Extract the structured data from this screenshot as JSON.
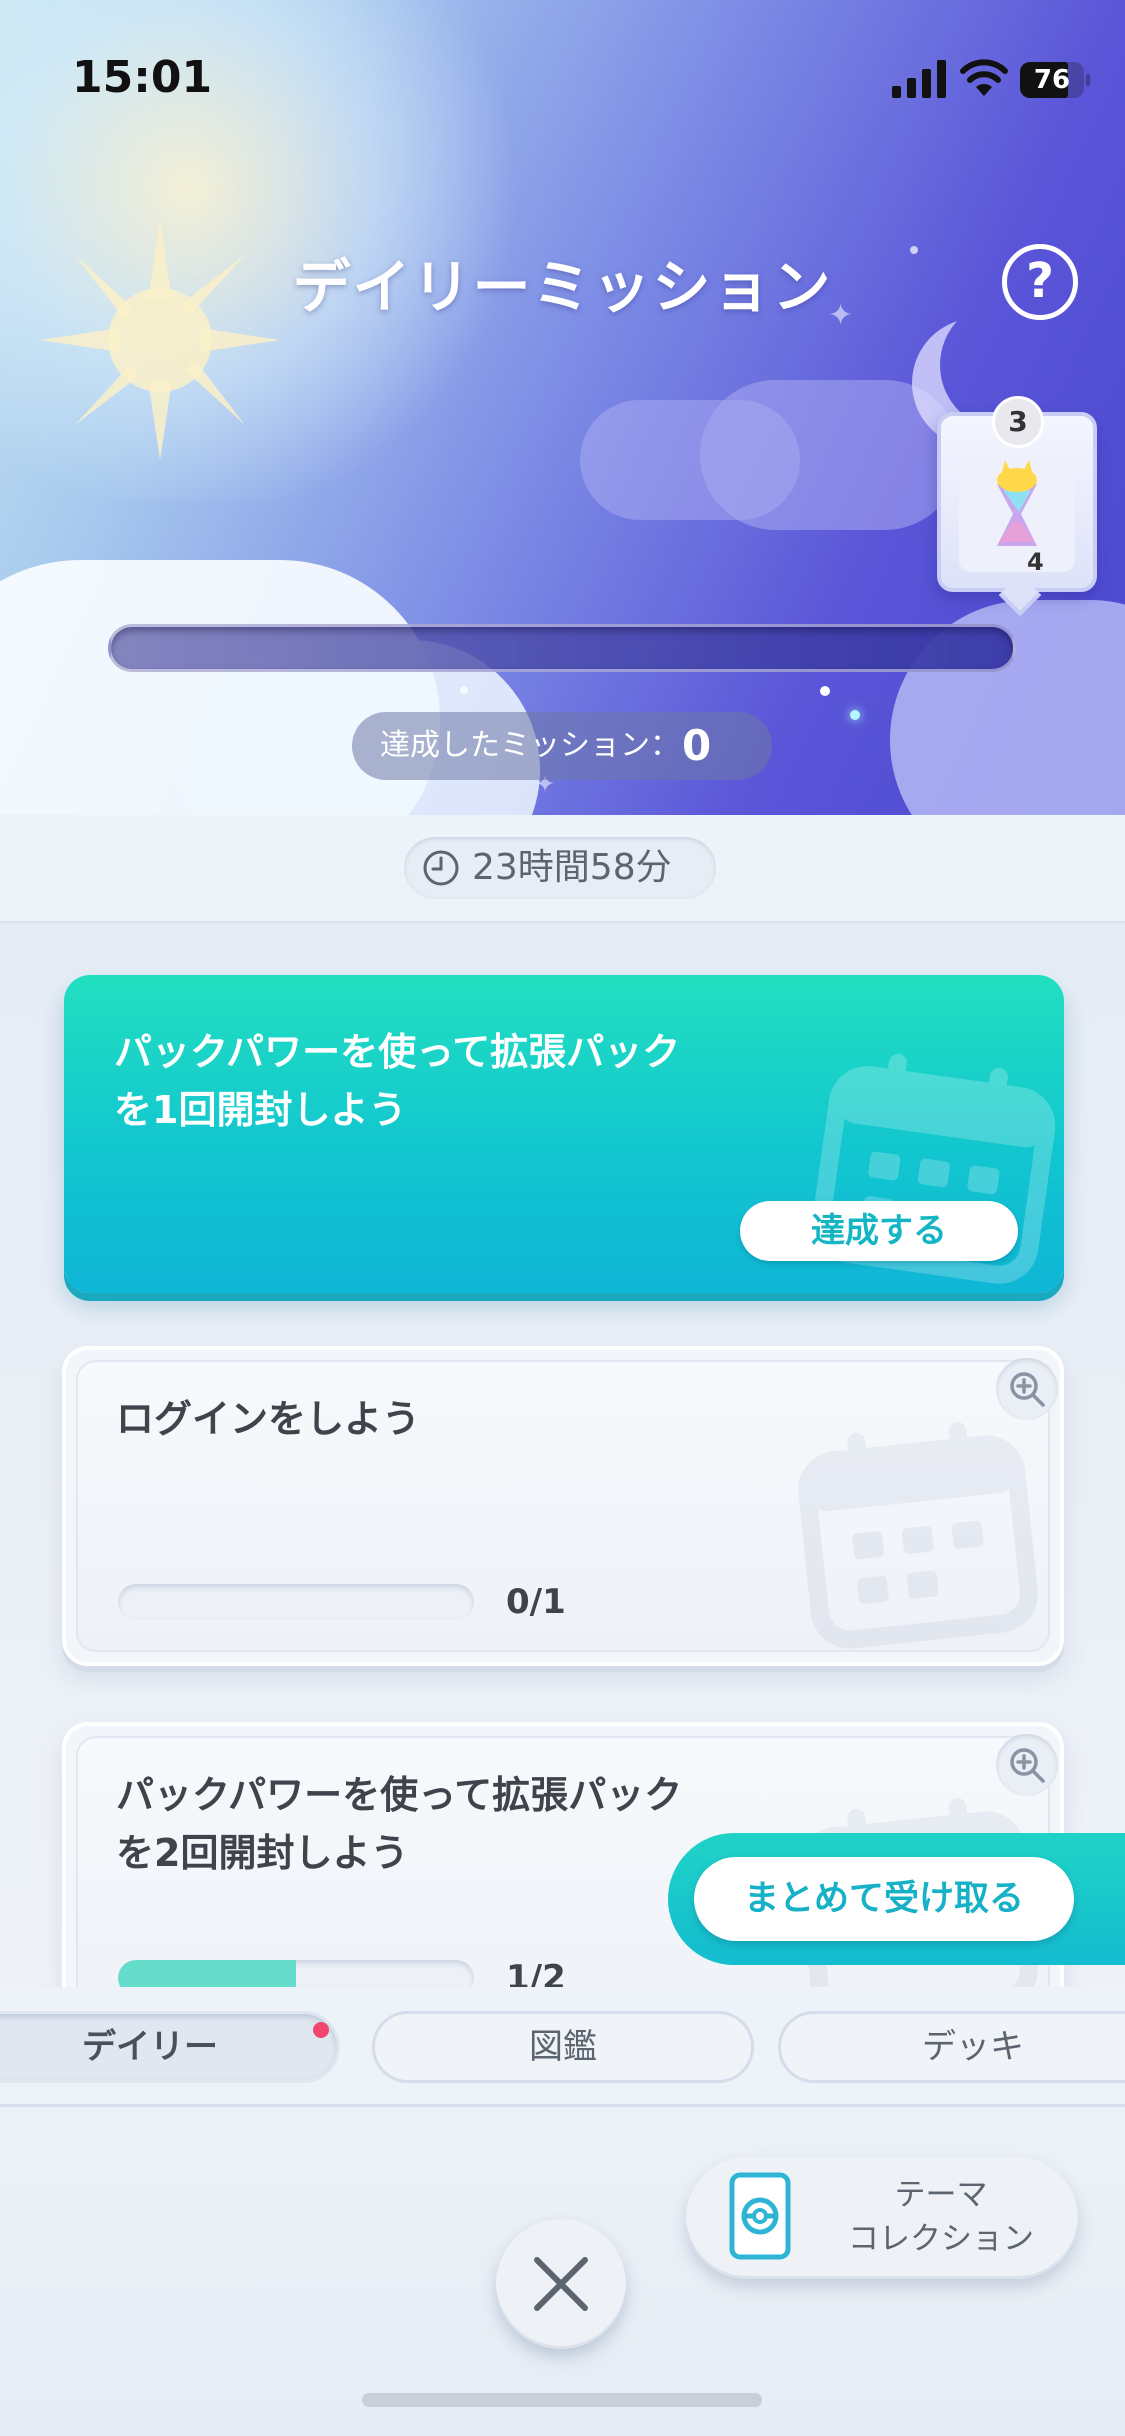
{
  "status_bar": {
    "time": "15:01",
    "battery_level": "76",
    "icons": [
      "cellular-signal-icon",
      "wifi-icon",
      "battery-icon"
    ]
  },
  "header": {
    "title": "デイリーミッション",
    "help_symbol": "?",
    "reward": {
      "badge": "3",
      "count": "4"
    },
    "mission_progress": 0,
    "completed_label": "達成したミッション：",
    "completed_count": "0"
  },
  "timer": {
    "remaining": "23時間58分",
    "icon": "clock-icon"
  },
  "missions": [
    {
      "title": "パックパワーを使って拡張パックを1回開封しよう",
      "state": "achievable",
      "button_label": "達成する"
    },
    {
      "title": "ログインをしよう",
      "state": "in_progress",
      "progress_text": "0/1",
      "progress": 0
    },
    {
      "title": "パックパワーを使って拡張パックを2回開封しよう",
      "state": "in_progress",
      "progress_text": "1/2",
      "progress": 0.5
    }
  ],
  "claim_all_label": "まとめて受け取る",
  "tabs": [
    {
      "label": "デイリー",
      "active": true,
      "notification": true
    },
    {
      "label": "図鑑",
      "active": false
    },
    {
      "label": "デッキ",
      "active": false
    }
  ],
  "footer": {
    "theme_collection_label": "テーマ\nコレクション"
  },
  "colors": {
    "accent_teal": "#12c6cf",
    "notification": "#f0466f",
    "header_purple": "#5a55d8"
  }
}
